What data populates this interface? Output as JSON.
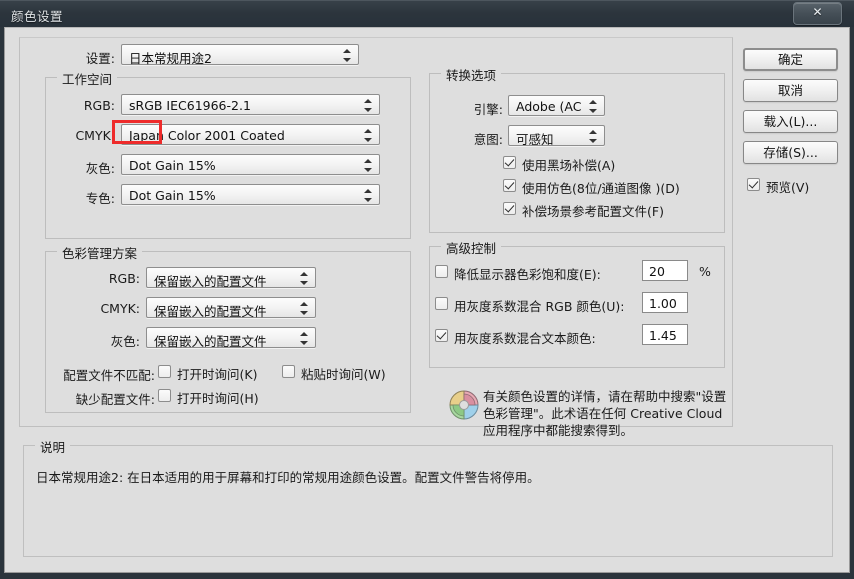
{
  "window": {
    "title": "颜色设置",
    "close_label": "✕"
  },
  "settings_row": {
    "label": "设置:",
    "value": "日本常规用途2"
  },
  "working_spaces": {
    "group_label": "工作空间",
    "rows": [
      {
        "label": "RGB:",
        "value": "sRGB IEC61966-2.1"
      },
      {
        "label": "CMYK:",
        "value": "Japan Color 2001 Coated"
      },
      {
        "label": "灰色:",
        "value": "Dot Gain 15%"
      },
      {
        "label": "专色:",
        "value": "Dot Gain 15%"
      }
    ]
  },
  "color_management_policies": {
    "group_label": "色彩管理方案",
    "rows": [
      {
        "label": "RGB:",
        "value": "保留嵌入的配置文件"
      },
      {
        "label": "CMYK:",
        "value": "保留嵌入的配置文件"
      },
      {
        "label": "灰色:",
        "value": "保留嵌入的配置文件"
      }
    ],
    "mismatch_label": "配置文件不匹配:",
    "mismatch_options": [
      {
        "label": "打开时询问(K)",
        "checked": false
      },
      {
        "label": "粘贴时询问(W)",
        "checked": false
      }
    ],
    "missing_label": "缺少配置文件:",
    "missing_options": [
      {
        "label": "打开时询问(H)",
        "checked": false
      }
    ]
  },
  "conversion_options": {
    "group_label": "转换选项",
    "engine": {
      "label": "引擎:",
      "value": "Adobe (ACE)"
    },
    "intent": {
      "label": "意图:",
      "value": "可感知"
    },
    "checkboxes": [
      {
        "label": "使用黑场补偿(A)",
        "checked": true
      },
      {
        "label": "使用仿色(8位/通道图像 )(D)",
        "checked": true
      },
      {
        "label": "补偿场景参考配置文件(F)",
        "checked": true
      }
    ]
  },
  "advanced_controls": {
    "group_label": "高级控制",
    "rows": [
      {
        "label": "降低显示器色彩饱和度(E):",
        "checked": false,
        "value": "20",
        "suffix": "%"
      },
      {
        "label": "用灰度系数混合 RGB 颜色(U):",
        "checked": false,
        "value": "1.00",
        "suffix": ""
      },
      {
        "label": "用灰度系数混合文本颜色:",
        "checked": true,
        "value": "1.45",
        "suffix": ""
      }
    ]
  },
  "help_note": {
    "icon": "color-wheel-icon",
    "text": "有关颜色设置的详情，请在帮助中搜索\"设置色彩管理\"。此术语在任何 Creative Cloud 应用程序中都能搜索得到。"
  },
  "buttons": {
    "ok": "确定",
    "cancel": "取消",
    "load": "载入(L)...",
    "save": "存储(S)...",
    "preview": {
      "label": "预览(V)",
      "checked": true
    }
  },
  "description": {
    "group_label": "说明",
    "text": "日本常规用途2: 在日本适用的用于屏幕和打印的常规用途颜色设置。配置文件警告将停用。"
  },
  "colors": {
    "highlight": "#ee2b2b",
    "dialog_bg": "#dedede",
    "titlebar": "#2c353d"
  }
}
